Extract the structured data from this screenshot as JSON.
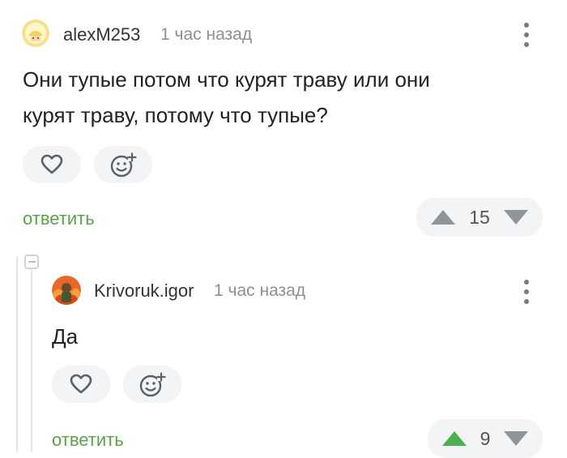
{
  "comments": [
    {
      "user": "alexM253",
      "time": "1 час назад",
      "text_lines": [
        "Они тупые потом что курят траву или они",
        "курят траву, потому что тупые?"
      ],
      "reply_label": "ответить",
      "rating": "15",
      "vote_state": "none"
    },
    {
      "user": "Krivoruk.igor",
      "time": "1 час назад",
      "text": "Да",
      "reply_label": "ответить",
      "rating": "9",
      "vote_state": "upvoted"
    }
  ],
  "colors": {
    "accent_green": "#5aa34a",
    "arrow_gray": "#8e9499",
    "upvote_active": "#4caf50",
    "pill_bg": "#f3f4f6"
  },
  "icons": [
    "heart-icon",
    "add-reaction-icon",
    "upvote-icon",
    "downvote-icon",
    "kebab-icon",
    "collapse-icon"
  ]
}
